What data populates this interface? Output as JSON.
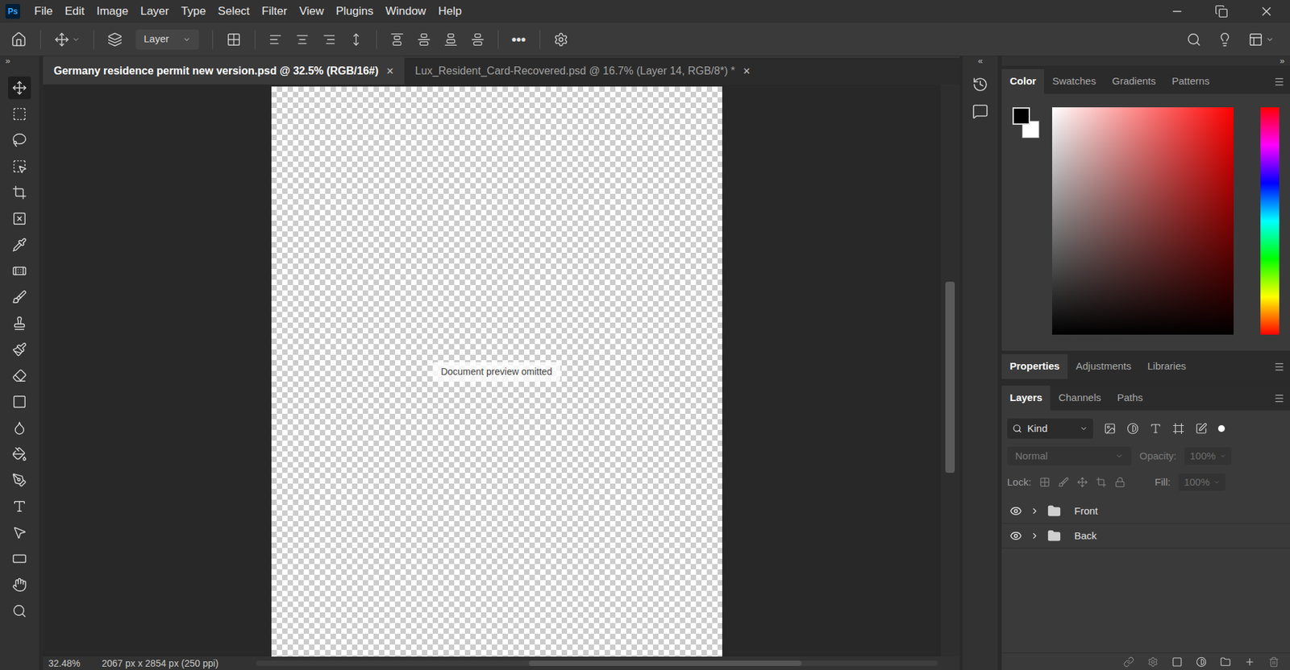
{
  "app": {
    "logo": "Ps"
  },
  "menu": [
    "File",
    "Edit",
    "Image",
    "Layer",
    "Type",
    "Select",
    "Filter",
    "View",
    "Plugins",
    "Window",
    "Help"
  ],
  "options_bar": {
    "mode": "Layer",
    "more": "•••"
  },
  "panel_toggles": {
    "left": "»",
    "middle": "«",
    "right": "»"
  },
  "tabs": [
    {
      "label": "Germany residence permit new version.psd @ 32.5% (RGB/16#)",
      "selected": true,
      "close": "×"
    },
    {
      "label": "Lux_Resident_Card-Recovered.psd @ 16.7% (Layer 14, RGB/8*) *",
      "selected": false,
      "close": "×"
    }
  ],
  "tools": [
    {
      "selected": true
    },
    {
      "selected": false
    },
    {
      "selected": false
    },
    {
      "selected": false
    },
    {
      "selected": false
    },
    {
      "selected": false
    },
    {
      "selected": false
    },
    {
      "selected": false
    },
    {
      "selected": false
    },
    {
      "selected": false
    },
    {
      "selected": false
    },
    {
      "selected": false
    },
    {
      "selected": false
    },
    {
      "selected": false
    },
    {
      "selected": false
    },
    {
      "selected": false
    },
    {
      "selected": false
    },
    {
      "selected": false
    },
    {
      "selected": false
    },
    {
      "selected": false
    },
    {
      "selected": false
    }
  ],
  "canvas": {
    "note": "Document preview omitted"
  },
  "status_bar": {
    "zoom": "32.48%",
    "size": "2067 px x 2854 px (250 ppi)"
  },
  "color_panel": {
    "tabs": [
      {
        "label": "Color",
        "selected": true
      },
      {
        "label": "Swatches",
        "selected": false
      },
      {
        "label": "Gradients",
        "selected": false
      },
      {
        "label": "Patterns",
        "selected": false
      }
    ],
    "foreground": "#000000",
    "background": "#ffffff",
    "hue": "#ff0000"
  },
  "properties_panel": {
    "tabs": [
      {
        "label": "Properties",
        "selected": true
      },
      {
        "label": "Adjustments",
        "selected": false
      },
      {
        "label": "Libraries",
        "selected": false
      }
    ]
  },
  "layers_panel": {
    "tabs": [
      {
        "label": "Layers",
        "selected": true
      },
      {
        "label": "Channels",
        "selected": false
      },
      {
        "label": "Paths",
        "selected": false
      }
    ],
    "filter": "Kind",
    "blend_mode": "Normal",
    "blend_disabled": true,
    "opacity_label": "Opacity:",
    "opacity": "100%",
    "opacity_disabled": true,
    "lock_label": "Lock:",
    "fill_label": "Fill:",
    "fill": "100%",
    "fill_disabled": true,
    "layers": [
      {
        "name": "Front",
        "visible": true,
        "expanded": false
      },
      {
        "name": "Back",
        "visible": true,
        "expanded": false
      }
    ]
  }
}
